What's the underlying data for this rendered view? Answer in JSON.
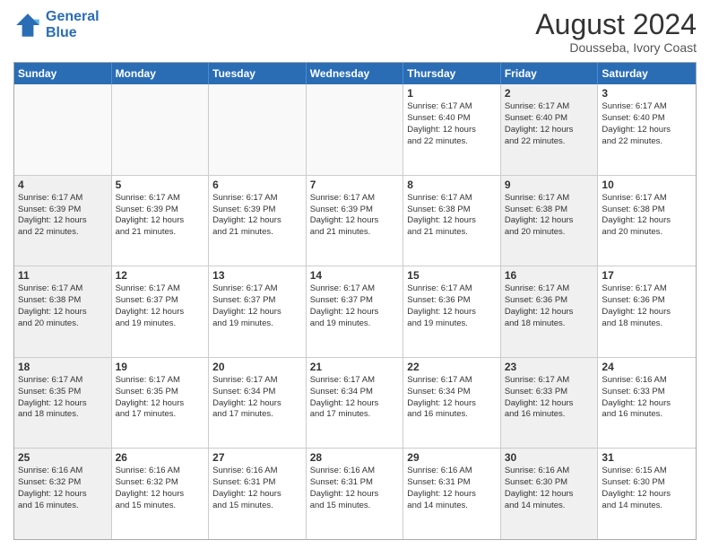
{
  "header": {
    "logo_line1": "General",
    "logo_line2": "Blue",
    "main_title": "August 2024",
    "subtitle": "Dousseba, Ivory Coast"
  },
  "days_of_week": [
    "Sunday",
    "Monday",
    "Tuesday",
    "Wednesday",
    "Thursday",
    "Friday",
    "Saturday"
  ],
  "weeks": [
    [
      {
        "day": "",
        "text": "",
        "empty": true
      },
      {
        "day": "",
        "text": "",
        "empty": true
      },
      {
        "day": "",
        "text": "",
        "empty": true
      },
      {
        "day": "",
        "text": "",
        "empty": true
      },
      {
        "day": "1",
        "text": "Sunrise: 6:17 AM\nSunset: 6:40 PM\nDaylight: 12 hours\nand 22 minutes.",
        "shaded": false
      },
      {
        "day": "2",
        "text": "Sunrise: 6:17 AM\nSunset: 6:40 PM\nDaylight: 12 hours\nand 22 minutes.",
        "shaded": true
      },
      {
        "day": "3",
        "text": "Sunrise: 6:17 AM\nSunset: 6:40 PM\nDaylight: 12 hours\nand 22 minutes.",
        "shaded": false
      }
    ],
    [
      {
        "day": "4",
        "text": "Sunrise: 6:17 AM\nSunset: 6:39 PM\nDaylight: 12 hours\nand 22 minutes.",
        "shaded": true
      },
      {
        "day": "5",
        "text": "Sunrise: 6:17 AM\nSunset: 6:39 PM\nDaylight: 12 hours\nand 21 minutes.",
        "shaded": false
      },
      {
        "day": "6",
        "text": "Sunrise: 6:17 AM\nSunset: 6:39 PM\nDaylight: 12 hours\nand 21 minutes.",
        "shaded": false
      },
      {
        "day": "7",
        "text": "Sunrise: 6:17 AM\nSunset: 6:39 PM\nDaylight: 12 hours\nand 21 minutes.",
        "shaded": false
      },
      {
        "day": "8",
        "text": "Sunrise: 6:17 AM\nSunset: 6:38 PM\nDaylight: 12 hours\nand 21 minutes.",
        "shaded": false
      },
      {
        "day": "9",
        "text": "Sunrise: 6:17 AM\nSunset: 6:38 PM\nDaylight: 12 hours\nand 20 minutes.",
        "shaded": true
      },
      {
        "day": "10",
        "text": "Sunrise: 6:17 AM\nSunset: 6:38 PM\nDaylight: 12 hours\nand 20 minutes.",
        "shaded": false
      }
    ],
    [
      {
        "day": "11",
        "text": "Sunrise: 6:17 AM\nSunset: 6:38 PM\nDaylight: 12 hours\nand 20 minutes.",
        "shaded": true
      },
      {
        "day": "12",
        "text": "Sunrise: 6:17 AM\nSunset: 6:37 PM\nDaylight: 12 hours\nand 19 minutes.",
        "shaded": false
      },
      {
        "day": "13",
        "text": "Sunrise: 6:17 AM\nSunset: 6:37 PM\nDaylight: 12 hours\nand 19 minutes.",
        "shaded": false
      },
      {
        "day": "14",
        "text": "Sunrise: 6:17 AM\nSunset: 6:37 PM\nDaylight: 12 hours\nand 19 minutes.",
        "shaded": false
      },
      {
        "day": "15",
        "text": "Sunrise: 6:17 AM\nSunset: 6:36 PM\nDaylight: 12 hours\nand 19 minutes.",
        "shaded": false
      },
      {
        "day": "16",
        "text": "Sunrise: 6:17 AM\nSunset: 6:36 PM\nDaylight: 12 hours\nand 18 minutes.",
        "shaded": true
      },
      {
        "day": "17",
        "text": "Sunrise: 6:17 AM\nSunset: 6:36 PM\nDaylight: 12 hours\nand 18 minutes.",
        "shaded": false
      }
    ],
    [
      {
        "day": "18",
        "text": "Sunrise: 6:17 AM\nSunset: 6:35 PM\nDaylight: 12 hours\nand 18 minutes.",
        "shaded": true
      },
      {
        "day": "19",
        "text": "Sunrise: 6:17 AM\nSunset: 6:35 PM\nDaylight: 12 hours\nand 17 minutes.",
        "shaded": false
      },
      {
        "day": "20",
        "text": "Sunrise: 6:17 AM\nSunset: 6:34 PM\nDaylight: 12 hours\nand 17 minutes.",
        "shaded": false
      },
      {
        "day": "21",
        "text": "Sunrise: 6:17 AM\nSunset: 6:34 PM\nDaylight: 12 hours\nand 17 minutes.",
        "shaded": false
      },
      {
        "day": "22",
        "text": "Sunrise: 6:17 AM\nSunset: 6:34 PM\nDaylight: 12 hours\nand 16 minutes.",
        "shaded": false
      },
      {
        "day": "23",
        "text": "Sunrise: 6:17 AM\nSunset: 6:33 PM\nDaylight: 12 hours\nand 16 minutes.",
        "shaded": true
      },
      {
        "day": "24",
        "text": "Sunrise: 6:16 AM\nSunset: 6:33 PM\nDaylight: 12 hours\nand 16 minutes.",
        "shaded": false
      }
    ],
    [
      {
        "day": "25",
        "text": "Sunrise: 6:16 AM\nSunset: 6:32 PM\nDaylight: 12 hours\nand 16 minutes.",
        "shaded": true
      },
      {
        "day": "26",
        "text": "Sunrise: 6:16 AM\nSunset: 6:32 PM\nDaylight: 12 hours\nand 15 minutes.",
        "shaded": false
      },
      {
        "day": "27",
        "text": "Sunrise: 6:16 AM\nSunset: 6:31 PM\nDaylight: 12 hours\nand 15 minutes.",
        "shaded": false
      },
      {
        "day": "28",
        "text": "Sunrise: 6:16 AM\nSunset: 6:31 PM\nDaylight: 12 hours\nand 15 minutes.",
        "shaded": false
      },
      {
        "day": "29",
        "text": "Sunrise: 6:16 AM\nSunset: 6:31 PM\nDaylight: 12 hours\nand 14 minutes.",
        "shaded": false
      },
      {
        "day": "30",
        "text": "Sunrise: 6:16 AM\nSunset: 6:30 PM\nDaylight: 12 hours\nand 14 minutes.",
        "shaded": true
      },
      {
        "day": "31",
        "text": "Sunrise: 6:15 AM\nSunset: 6:30 PM\nDaylight: 12 hours\nand 14 minutes.",
        "shaded": false
      }
    ]
  ]
}
